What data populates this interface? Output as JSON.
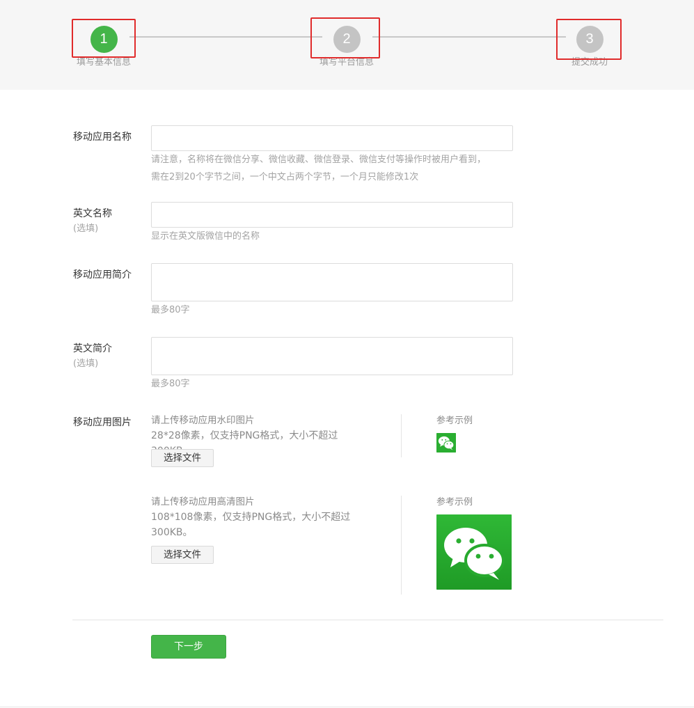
{
  "stepper": {
    "steps": [
      {
        "number": "1",
        "label": "填写基本信息"
      },
      {
        "number": "2",
        "label": "填写平台信息"
      },
      {
        "number": "3",
        "label": "提交成功"
      }
    ],
    "active_step": 1,
    "active_color": "#44b549",
    "inactive_color": "#c4c4c4",
    "highlight_color": "#e02b2b"
  },
  "form": {
    "app_name": {
      "label": "移动应用名称",
      "value": "",
      "tip_line1": "请注意，名称将在微信分享、微信收藏、微信登录、微信支付等操作时被用户看到，",
      "tip_line2": "需在2到20个字节之间，一个中文占两个字节，一个月只能修改1次"
    },
    "english_name": {
      "label": "英文名称",
      "optional": "(选填)",
      "value": "",
      "tip": "显示在英文版微信中的名称"
    },
    "app_intro": {
      "label": "移动应用简介",
      "value": "",
      "tip": "最多80字"
    },
    "english_intro": {
      "label": "英文简介",
      "optional": "(选填)",
      "value": "",
      "tip": "最多80字"
    },
    "app_images": {
      "label": "移动应用图片",
      "watermark": {
        "desc_line1": "请上传移动应用水印图片",
        "desc_line2": "28*28像素，仅支持PNG格式，大小不超过300KB。",
        "button_label": "选择文件",
        "sample_label": "参考示例",
        "sample_icon": "wechat-logo-icon"
      },
      "hd": {
        "desc_line1": "请上传移动应用高清图片",
        "desc_line2": "108*108像素，仅支持PNG格式，大小不超过",
        "desc_line3": "300KB。",
        "button_label": "选择文件",
        "sample_label": "参考示例",
        "sample_icon": "wechat-logo-icon"
      }
    },
    "next_button_label": "下一步"
  }
}
